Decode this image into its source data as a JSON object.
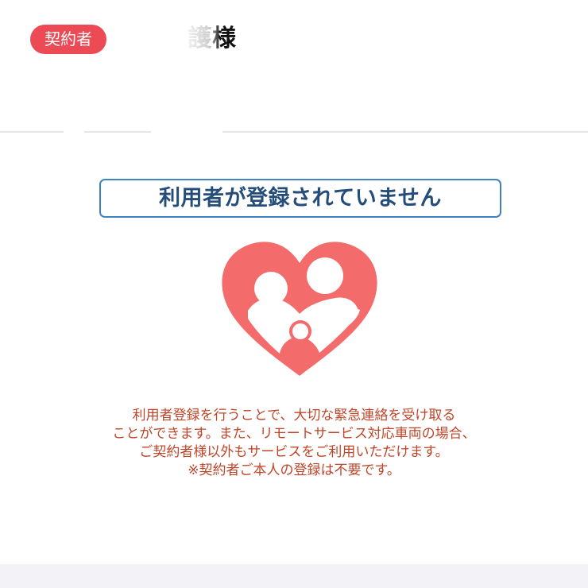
{
  "header": {
    "role_badge": "契約者",
    "user_name": "護様"
  },
  "status": {
    "message": "利用者が登録されていません"
  },
  "illustration": {
    "icon": "family-heart-icon",
    "heart_color": "#f36b6b"
  },
  "info": {
    "lines": [
      "利用者登録を行うことで、大切な緊急連絡を受け取る",
      "ことができます。また、リモートサービス対応車両の場合、",
      "ご契約者様以外もサービスをご利用いただけます。",
      "※契約者ご本人の登録は不要です。"
    ]
  },
  "colors": {
    "badge": "#ec4b55",
    "status_border": "#3f82c4",
    "status_text": "#254d79",
    "info_text": "#bf4528"
  }
}
